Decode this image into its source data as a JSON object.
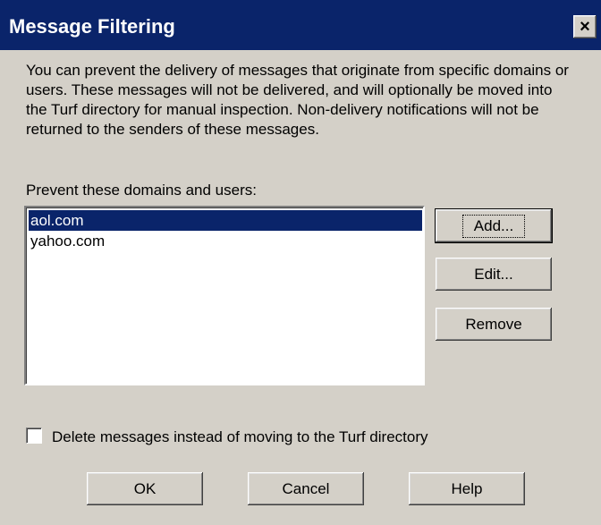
{
  "window": {
    "title": "Message Filtering",
    "close_glyph": "×"
  },
  "intro_text": "You can prevent the delivery of messages that originate from specific domains or users.  These messages will not be delivered, and will optionally be moved into the Turf directory for manual inspection. Non-delivery notifications will not be returned to the senders of these messages.",
  "list": {
    "label": "Prevent these domains and users:",
    "items": [
      {
        "label": "aol.com",
        "selected": true
      },
      {
        "label": "yahoo.com",
        "selected": false
      }
    ]
  },
  "buttons": {
    "add": "Add...",
    "edit": "Edit...",
    "remove": "Remove",
    "ok": "OK",
    "cancel": "Cancel",
    "help": "Help"
  },
  "option": {
    "delete_label": "Delete messages instead of moving to the Turf directory",
    "checked": false
  },
  "colors": {
    "title_bar": "#0a246a",
    "dialog_face": "#d4d0c8",
    "selection": "#0a246a"
  }
}
